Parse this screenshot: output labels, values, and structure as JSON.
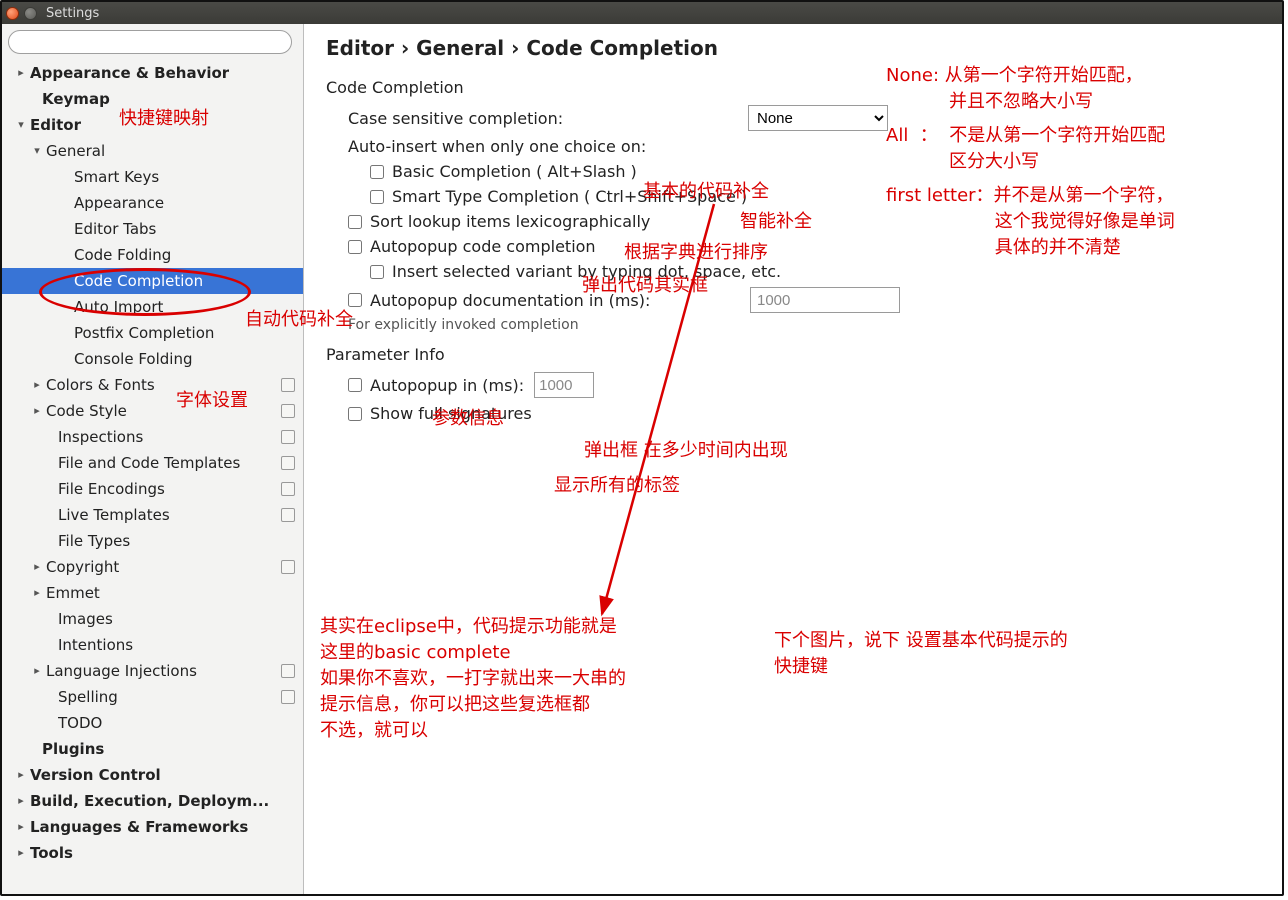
{
  "window": {
    "title": "Settings"
  },
  "breadcrumb": "Editor › General › Code Completion",
  "sidebar": {
    "items": [
      {
        "label": "Appearance & Behavior",
        "indent": 14,
        "arrow": "▸",
        "bold": true
      },
      {
        "label": "Keymap",
        "indent": 26,
        "arrow": "",
        "bold": true
      },
      {
        "label": "Editor",
        "indent": 14,
        "arrow": "▾",
        "bold": true
      },
      {
        "label": "General",
        "indent": 30,
        "arrow": "▾",
        "bold": false
      },
      {
        "label": "Smart Keys",
        "indent": 58,
        "arrow": "",
        "bold": false
      },
      {
        "label": "Appearance",
        "indent": 58,
        "arrow": "",
        "bold": false
      },
      {
        "label": "Editor Tabs",
        "indent": 58,
        "arrow": "",
        "bold": false
      },
      {
        "label": "Code Folding",
        "indent": 58,
        "arrow": "",
        "bold": false
      },
      {
        "label": "Code Completion",
        "indent": 58,
        "arrow": "",
        "bold": false,
        "selected": true
      },
      {
        "label": "Auto Import",
        "indent": 58,
        "arrow": "",
        "bold": false
      },
      {
        "label": "Postfix Completion",
        "indent": 58,
        "arrow": "",
        "bold": false
      },
      {
        "label": "Console Folding",
        "indent": 58,
        "arrow": "",
        "bold": false
      },
      {
        "label": "Colors & Fonts",
        "indent": 30,
        "arrow": "▸",
        "bold": false,
        "badge": true
      },
      {
        "label": "Code Style",
        "indent": 30,
        "arrow": "▸",
        "bold": false,
        "badge": true
      },
      {
        "label": "Inspections",
        "indent": 42,
        "arrow": "",
        "bold": false,
        "badge": true
      },
      {
        "label": "File and Code Templates",
        "indent": 42,
        "arrow": "",
        "bold": false,
        "badge": true
      },
      {
        "label": "File Encodings",
        "indent": 42,
        "arrow": "",
        "bold": false,
        "badge": true
      },
      {
        "label": "Live Templates",
        "indent": 42,
        "arrow": "",
        "bold": false,
        "badge": true
      },
      {
        "label": "File Types",
        "indent": 42,
        "arrow": "",
        "bold": false
      },
      {
        "label": "Copyright",
        "indent": 30,
        "arrow": "▸",
        "bold": false,
        "badge": true
      },
      {
        "label": "Emmet",
        "indent": 30,
        "arrow": "▸",
        "bold": false
      },
      {
        "label": "Images",
        "indent": 42,
        "arrow": "",
        "bold": false
      },
      {
        "label": "Intentions",
        "indent": 42,
        "arrow": "",
        "bold": false
      },
      {
        "label": "Language Injections",
        "indent": 30,
        "arrow": "▸",
        "bold": false,
        "badge": true
      },
      {
        "label": "Spelling",
        "indent": 42,
        "arrow": "",
        "bold": false,
        "badge": true
      },
      {
        "label": "TODO",
        "indent": 42,
        "arrow": "",
        "bold": false
      },
      {
        "label": "Plugins",
        "indent": 26,
        "arrow": "",
        "bold": true
      },
      {
        "label": "Version Control",
        "indent": 14,
        "arrow": "▸",
        "bold": true
      },
      {
        "label": "Build, Execution, Deploym...",
        "indent": 14,
        "arrow": "▸",
        "bold": true
      },
      {
        "label": "Languages & Frameworks",
        "indent": 14,
        "arrow": "▸",
        "bold": true
      },
      {
        "label": "Tools",
        "indent": 14,
        "arrow": "▸",
        "bold": true
      }
    ]
  },
  "section": {
    "codeCompletion": "Code Completion",
    "caseSensitive": "Case sensitive completion:",
    "caseSelect": "None",
    "autoInsert": "Auto-insert when only one choice on:",
    "basic": "Basic Completion ( Alt+Slash )",
    "smart": "Smart Type Completion ( Ctrl+Shift+Space )",
    "sortLex": "Sort lookup items lexicographically",
    "autopop": "Autopopup code completion",
    "insertVariant": "Insert selected variant by typing dot, space, etc.",
    "autodoc": "Autopopup documentation in (ms):",
    "autodocVal": "1000",
    "autodocHint": "For explicitly invoked completion",
    "paramInfo": "Parameter Info",
    "paramAuto": "Autopopup in (ms):",
    "paramAutoVal": "1000",
    "showFull": "Show full signatures"
  },
  "anno": {
    "a1": "快捷键映射",
    "a2": "自动代码补全",
    "a3": "字体设置",
    "a4": "基本的代码补全",
    "a5": "智能补全",
    "a6": "根据字典进行排序",
    "a7": "弹出代码其实框",
    "a8": "参数信息",
    "a9": "弹出框 在多少时间内出现",
    "a10": "显示所有的标签",
    "none": "None: 从第一个字符开始匹配，\n           并且不忽略大小写",
    "all": "All  ：  不是从第一个字符开始匹配\n           区分大小写",
    "first": "first letter：并不是从第一个字符，\n                   这个我觉得好像是单词\n                   具体的并不清楚",
    "para1": "其实在eclipse中，代码提示功能就是\n这里的basic complete\n如果你不喜欢，一打字就出来一大串的\n提示信息，你可以把这些复选框都\n不选，就可以",
    "para2": "下个图片，说下 设置基本代码提示的\n快捷键"
  }
}
